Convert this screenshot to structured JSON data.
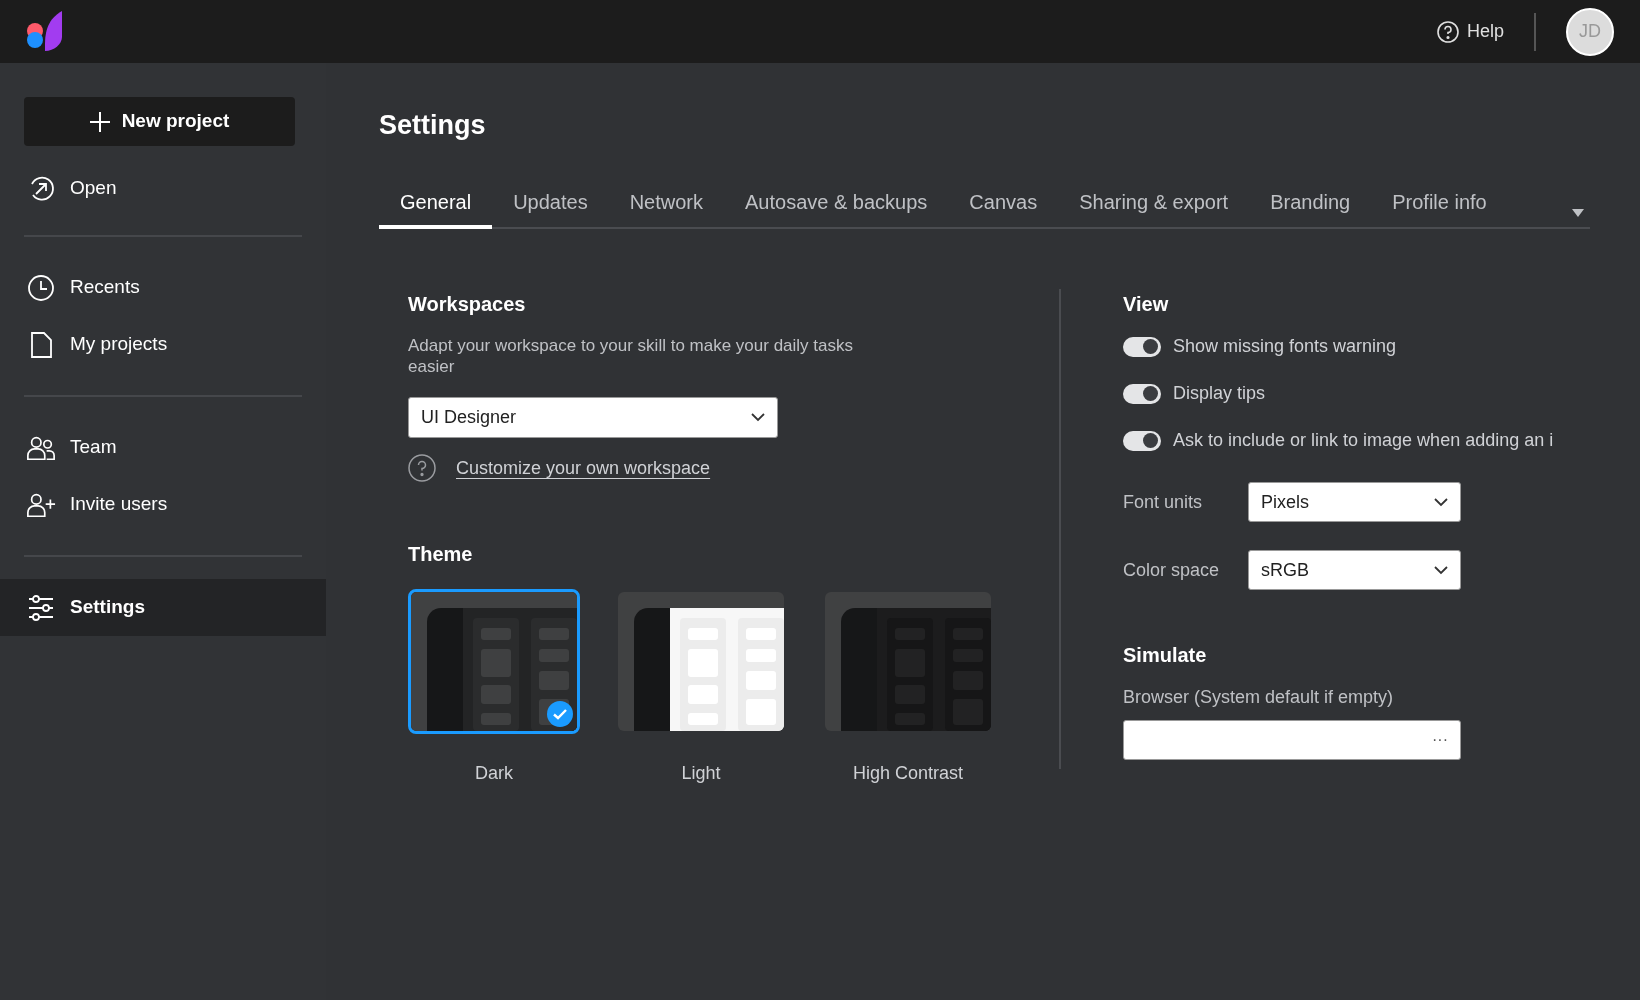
{
  "top_bar": {
    "help": "Help",
    "avatar": "JD"
  },
  "sidebar": {
    "new_project": "New project",
    "groups": [
      [
        {
          "label": "Open",
          "kind": "open",
          "selected": false
        }
      ],
      [
        {
          "label": "Recents",
          "kind": "clock",
          "selected": false
        },
        {
          "label": "My projects",
          "kind": "file",
          "selected": false
        }
      ],
      [
        {
          "label": "Team",
          "kind": "team",
          "selected": false
        },
        {
          "label": "Invite users",
          "kind": "invite",
          "selected": false
        }
      ],
      [
        {
          "label": "Settings",
          "kind": "sliders",
          "selected": true
        }
      ]
    ]
  },
  "title": "Settings",
  "tabs": [
    {
      "label": "General",
      "selected": true
    },
    {
      "label": "Updates",
      "selected": false
    },
    {
      "label": "Network",
      "selected": false
    },
    {
      "label": "Autosave & backups",
      "selected": false
    },
    {
      "label": "Canvas",
      "selected": false
    },
    {
      "label": "Sharing & export",
      "selected": false
    },
    {
      "label": "Branding",
      "selected": false
    },
    {
      "label": "Profile info",
      "selected": false
    }
  ],
  "workspaces": {
    "heading": "Workspaces",
    "description": "Adapt your workspace to your skill to make your daily tasks easier",
    "value": "UI Designer",
    "link": "Customize your own workspace"
  },
  "theme": {
    "heading": "Theme",
    "options": [
      {
        "label": "Dark",
        "kind": "dark",
        "selected": true
      },
      {
        "label": "Light",
        "kind": "light",
        "selected": false
      },
      {
        "label": "High Contrast",
        "kind": "contrast",
        "selected": false
      }
    ]
  },
  "view": {
    "heading": "View",
    "toggles": [
      {
        "label": "Show missing fonts warning",
        "on": true
      },
      {
        "label": "Display tips",
        "on": true
      },
      {
        "label": "Ask to include or link to image when adding an i",
        "on": true
      }
    ],
    "selects": [
      {
        "label": "Font units",
        "value": "Pixels"
      },
      {
        "label": "Color space",
        "value": "sRGB"
      }
    ]
  },
  "simulate": {
    "heading": "Simulate",
    "label": "Browser (System default if empty)",
    "button": "···"
  }
}
